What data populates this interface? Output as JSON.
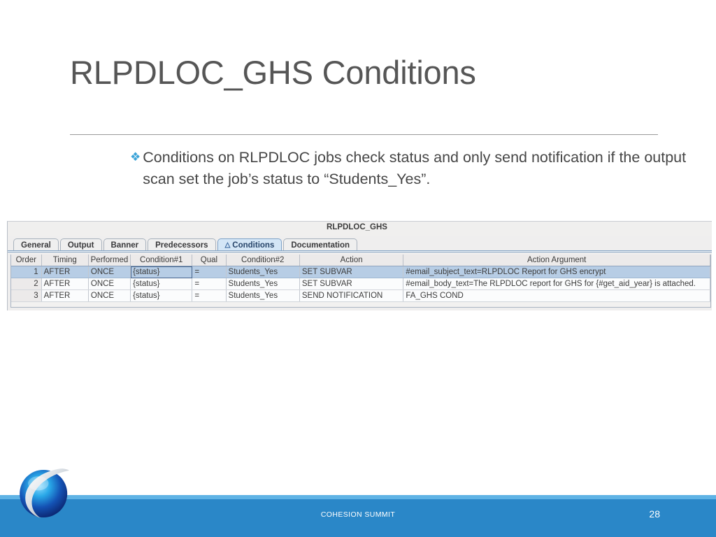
{
  "slide": {
    "title": "RLPDLOC_GHS Conditions",
    "bullet_marker": "❖",
    "bullet_text": "Conditions on RLPDLOC jobs check status and only send notification if the output scan set the job’s status to “Students_Yes”."
  },
  "app": {
    "window_title": "RLPDLOC_GHS",
    "tabs": [
      {
        "label": "General",
        "active": false,
        "icon": ""
      },
      {
        "label": "Output",
        "active": false,
        "icon": ""
      },
      {
        "label": "Banner",
        "active": false,
        "icon": ""
      },
      {
        "label": "Predecessors",
        "active": false,
        "icon": ""
      },
      {
        "label": "Conditions",
        "active": true,
        "icon": "△"
      },
      {
        "label": "Documentation",
        "active": false,
        "icon": ""
      }
    ],
    "grid": {
      "columns": [
        "Order",
        "Timing",
        "Performed",
        "Condition#1",
        "Qual",
        "Condition#2",
        "Action",
        "Action Argument"
      ],
      "rows": [
        {
          "selected": true,
          "cells": [
            "1",
            "AFTER",
            "ONCE",
            "{status}",
            "=",
            "Students_Yes",
            "SET SUBVAR",
            "#email_subject_text=RLPDLOC Report for GHS encrypt"
          ]
        },
        {
          "selected": false,
          "cells": [
            "2",
            "AFTER",
            "ONCE",
            "{status}",
            "=",
            "Students_Yes",
            "SET SUBVAR",
            "#email_body_text=The RLPDLOC report for GHS for {#get_aid_year} is attached."
          ]
        },
        {
          "selected": false,
          "cells": [
            "3",
            "AFTER",
            "ONCE",
            "{status}",
            "=",
            "Students_Yes",
            "SEND NOTIFICATION",
            "FA_GHS COND"
          ]
        }
      ]
    }
  },
  "footer": {
    "text": "COHESION SUMMIT",
    "page_number": "28"
  },
  "colors": {
    "accent_blue": "#2a87c8",
    "strip_blue": "#5fb3e5",
    "bullet_blue": "#3ba3d8",
    "selection_blue": "#b7cde5"
  }
}
